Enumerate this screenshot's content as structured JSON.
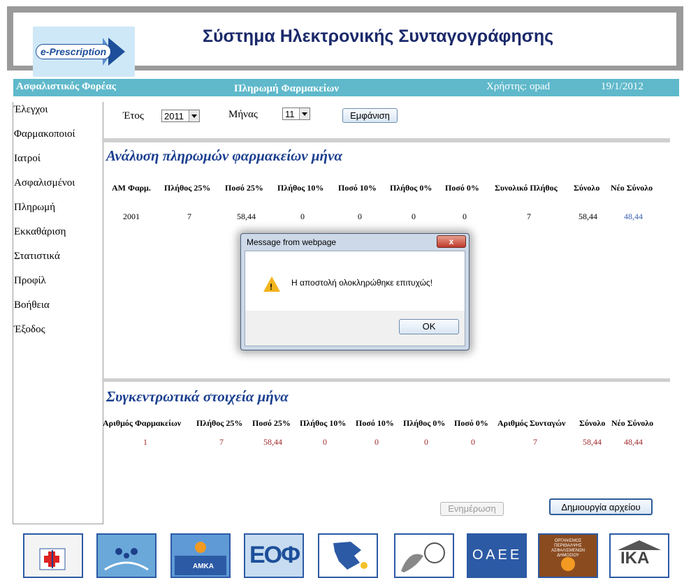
{
  "header": {
    "logo_text": "e-Prescription",
    "title": "Σύστημα Ηλεκτρονικής Συνταγογράφησης"
  },
  "topbar": {
    "insurer": "Ασφαλιστικός Φορέας",
    "page": "Πληρωμή Φαρμακείων",
    "user": "Χρήστης: opad",
    "date": "19/1/2012"
  },
  "sidebar": {
    "items": [
      "Έλεγχοι",
      "Φαρμακοποιοί",
      "Ιατροί",
      "Ασφαλισμένοι",
      "Πληρωμή",
      "Εκκαθάριση",
      "Στατιστικά",
      "Προφίλ",
      "Βοήθεια",
      "Έξοδος"
    ]
  },
  "filters": {
    "year_label": "Έτος",
    "year_value": "2011",
    "month_label": "Μήνας",
    "month_value": "11",
    "show_button": "Εμφάνιση"
  },
  "analysis": {
    "title": "Ανάλυση πληρωμών φαρμακείων μήνα",
    "headers": [
      "ΑΜ Φαρμ.",
      "Πλήθος 25%",
      "Ποσό 25%",
      "Πλήθος 10%",
      "Ποσό 10%",
      "Πλήθος 0%",
      "Ποσό 0%",
      "Συνολικό Πλήθος",
      "Σύνολο",
      "Νέο Σύνολο"
    ],
    "rows": [
      [
        "2001",
        "7",
        "58,44",
        "0",
        "0",
        "0",
        "0",
        "7",
        "58,44",
        "48,44"
      ]
    ]
  },
  "summary": {
    "title": "Συγκεντρωτικά στοιχεία μήνα",
    "headers": [
      "Αριθμός Φαρμακείων",
      "Πλήθος 25%",
      "Ποσό 25%",
      "Πλήθος 10%",
      "Ποσό 10%",
      "Πλήθος 0%",
      "Ποσό 0%",
      "Αριθμός Συνταγών",
      "Σύνολο",
      "Νέο Σύνολο"
    ],
    "row": [
      "1",
      "7",
      "58,44",
      "0",
      "0",
      "0",
      "0",
      "7",
      "58,44",
      "48,44"
    ]
  },
  "actions": {
    "update_button": "Ενημέρωση",
    "create_file_button": "Δημιουργία αρχείου"
  },
  "dialog": {
    "title": "Message from webpage",
    "close": "x",
    "message": "Η αποστολή ολοκληρώθηκε επιτυχώς!",
    "ok": "OK"
  },
  "footer": {
    "logos": [
      "ministry-health-logo",
      "family-hands-logo",
      "amka-logo",
      "eof-logo",
      "medical-association-logo",
      "archive-seal-logo",
      "oaee-logo",
      "opad-logo",
      "ika-logo"
    ],
    "logo_texts": {
      "amka": "ΑΜΚΑ",
      "eof": "ΕΟΦ",
      "oaee": "ΟΑΕΕ",
      "opad": "ΟΡΓΑΝΙΣΜΟΣ ΠΕΡΙΘΑΛΨΗΣ ΑΣΦΑΛΙΣΜΕΝΩΝ ΔΗΜΟΣΙΟΥ",
      "ika": "ΙΚΑ"
    }
  },
  "colors": {
    "topbar": "#5fb9cb",
    "section_title": "#1b3f8f",
    "summary_values": "#a0282a",
    "new_total": "#3a5fb4"
  }
}
